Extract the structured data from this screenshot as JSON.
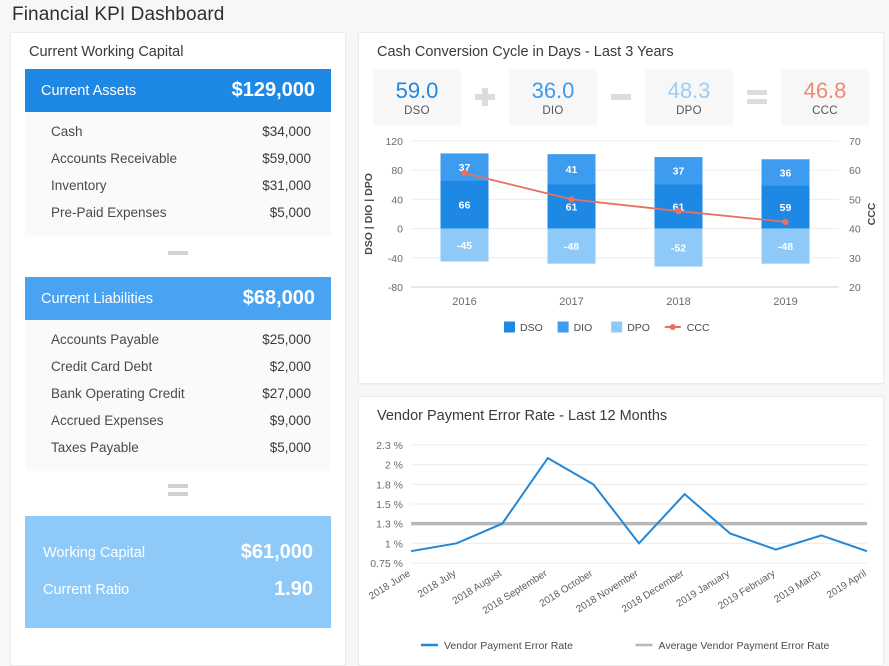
{
  "page": {
    "title": "Financial KPI Dashboard"
  },
  "colors": {
    "dso": "#1e88e5",
    "dio": "#3d9bf0",
    "dpo": "#8ec9f7",
    "ccc": "#e8705e",
    "assets_bar": "#1e88e5",
    "liabilities_bar": "#48a3f3",
    "total_block": "#8ec9f7",
    "error_line": "#2387d6",
    "avg_line": "#b8b8b8",
    "grid": "#ededed",
    "axis_text": "#6b6b6b"
  },
  "working_capital": {
    "panel_title": "Current Working Capital",
    "assets": {
      "label": "Current Assets",
      "value": "$129,000"
    },
    "asset_rows": [
      {
        "label": "Cash",
        "value": "$34,000"
      },
      {
        "label": "Accounts Receivable",
        "value": "$59,000"
      },
      {
        "label": "Inventory",
        "value": "$31,000"
      },
      {
        "label": "Pre-Paid Expenses",
        "value": "$5,000"
      }
    ],
    "operator_1": "minus-sign",
    "liabilities": {
      "label": "Current Liabilities",
      "value": "$68,000"
    },
    "liability_rows": [
      {
        "label": "Accounts Payable",
        "value": "$25,000"
      },
      {
        "label": "Credit Card Debt",
        "value": "$2,000"
      },
      {
        "label": "Bank Operating Credit",
        "value": "$27,000"
      },
      {
        "label": "Accrued Expenses",
        "value": "$9,000"
      },
      {
        "label": "Taxes Payable",
        "value": "$5,000"
      }
    ],
    "operator_2": "equals-sign",
    "totals": [
      {
        "label": "Working Capital",
        "value": "$61,000"
      },
      {
        "label": "Current Ratio",
        "value": "1.90"
      }
    ]
  },
  "ccc_panel": {
    "panel_title": "Cash Conversion Cycle in Days - Last 3 Years",
    "cards": [
      {
        "value": "59.0",
        "name": "DSO",
        "color": "#1e88e5"
      },
      {
        "value": "36.0",
        "name": "DIO",
        "color": "#3d9bf0"
      },
      {
        "value": "48.3",
        "name": "DPO",
        "color": "#9ccdf7"
      },
      {
        "value": "46.8",
        "name": "CCC",
        "color": "#ef8a7a"
      }
    ],
    "operators": [
      "plus-sign",
      "minus-sign",
      "equals-sign"
    ]
  },
  "chart_data": [
    {
      "type": "bar",
      "id": "cash-conversion-cycle",
      "title": "Cash Conversion Cycle in Days - Last 3 Years",
      "categories": [
        "2016",
        "2017",
        "2018",
        "2019"
      ],
      "stacked": true,
      "series": [
        {
          "name": "DSO",
          "values": [
            66,
            61,
            61,
            59
          ],
          "color": "#1e88e5",
          "axis": "left"
        },
        {
          "name": "DIO",
          "values": [
            37,
            41,
            37,
            36
          ],
          "color": "#3d9bf0",
          "axis": "left"
        },
        {
          "name": "DPO",
          "values": [
            -45,
            -48,
            -52,
            -48
          ],
          "color": "#8ec9f7",
          "axis": "left"
        },
        {
          "name": "CCC",
          "values": [
            59.0,
            50.0,
            46.0,
            42.3
          ],
          "color": "#e8705e",
          "axis": "right",
          "render": "line"
        }
      ],
      "ylabel": "DSO | DIO | DPO",
      "ylim": [
        -80,
        120
      ],
      "yticks": [
        -80,
        -40,
        0,
        40,
        80,
        120
      ],
      "y2label": "CCC",
      "y2lim": [
        20,
        70
      ],
      "y2ticks": [
        20,
        30,
        40,
        50,
        60,
        70
      ],
      "xlabel": "",
      "grid": true,
      "legend": "bottom",
      "legend_entries": [
        "DSO",
        "DIO",
        "DPO",
        "CCC"
      ]
    },
    {
      "type": "line",
      "id": "vendor-payment-error-rate",
      "title": "Vendor Payment Error Rate - Last 12 Months",
      "categories": [
        "2018 June",
        "2018 July",
        "2018 August",
        "2018 September",
        "2018 October",
        "2018 November",
        "2018 December",
        "2019 January",
        "2019 February",
        "2019 March",
        "2019 April"
      ],
      "series": [
        {
          "name": "Vendor Payment Error Rate",
          "color": "#2387d6",
          "values": [
            0.9,
            1.0,
            1.3,
            2.1,
            1.8,
            1.0,
            1.65,
            1.15,
            0.92,
            1.12,
            0.9
          ]
        },
        {
          "name": "Average Vendor Payment Error Rate",
          "color": "#b8b8b8",
          "style": "flat",
          "values": [
            1.3,
            1.3,
            1.3,
            1.3,
            1.3,
            1.3,
            1.3,
            1.3,
            1.3,
            1.3,
            1.3
          ]
        }
      ],
      "ylabel": "",
      "ytick_labels": [
        "2.3 %",
        "2 %",
        "1.8 %",
        "1.5 %",
        "1.3 %",
        "1 %",
        "0.75 %"
      ],
      "ytick_values": [
        2.3,
        2.0,
        1.8,
        1.5,
        1.3,
        1.0,
        0.75
      ],
      "grid": true,
      "legend": "bottom",
      "legend_entries": [
        "Vendor Payment Error Rate",
        "Average Vendor Payment Error Rate"
      ]
    }
  ]
}
